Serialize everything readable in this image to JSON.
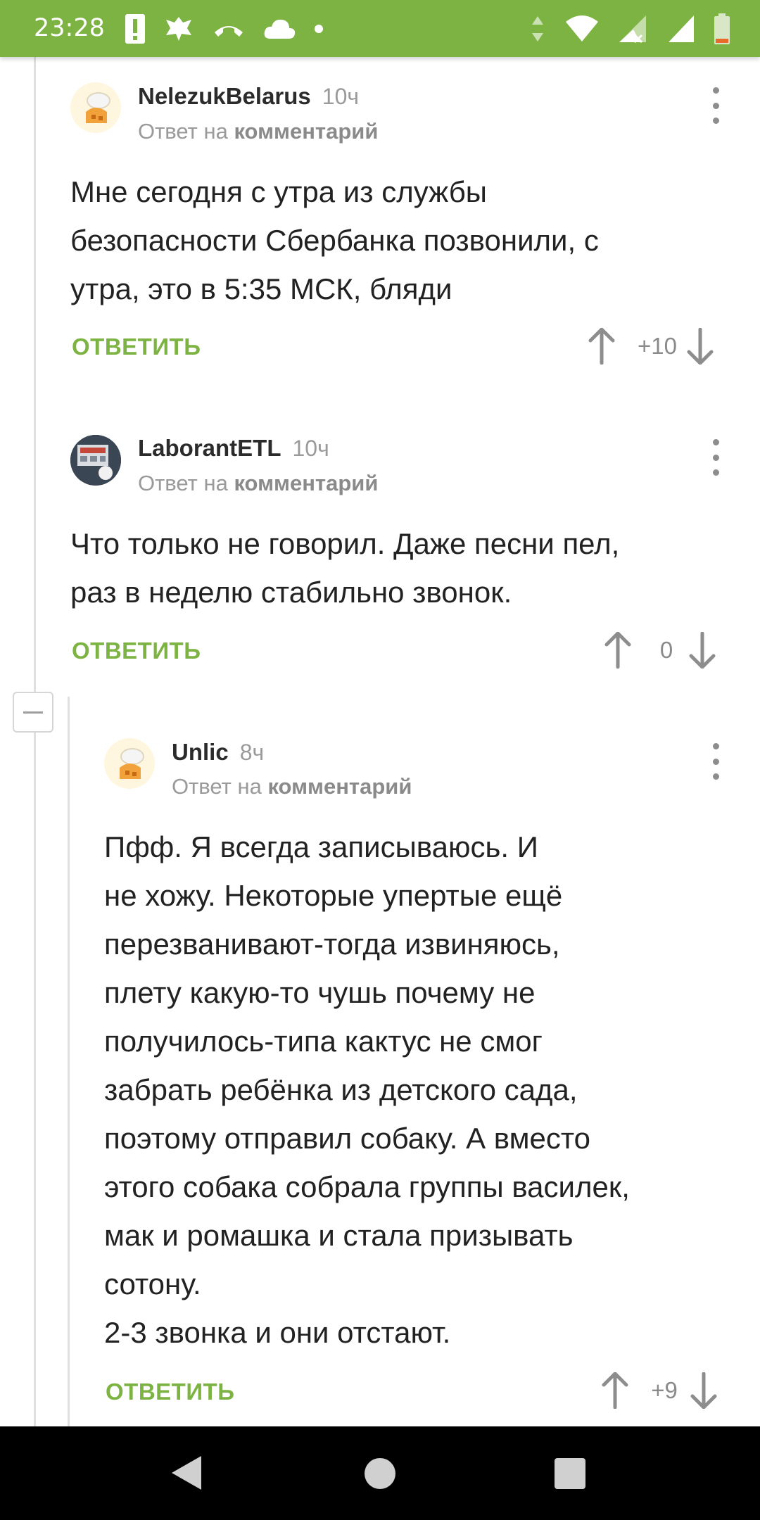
{
  "status_bar": {
    "time": "23:28",
    "left_icons": [
      "alert-icon",
      "emblem-icon",
      "missed-call-icon",
      "cloud-icon",
      "dot-icon"
    ],
    "right_icons": [
      "data-arrows-icon",
      "wifi-icon",
      "signal-no-data-icon",
      "signal-icon",
      "battery-icon"
    ]
  },
  "reply_label": "ОТВЕТИТЬ",
  "comments": [
    {
      "author": "NelezukBelarus",
      "time": "10ч",
      "reply_prefix": "Ответ на",
      "reply_link": "комментарий",
      "lines": [
        "Мне сегодня с утра из службы",
        "безопасности Сбербанка позвонили, с",
        "утра, это в 5:35 МСК, бляди"
      ],
      "score": "+10"
    },
    {
      "author": "LaborantETL",
      "time": "10ч",
      "reply_prefix": "Ответ на",
      "reply_link": "комментарий",
      "lines": [
        "Что только не говорил. Даже песни пел,",
        "раз в неделю стабильно звонок."
      ],
      "score": "0"
    },
    {
      "author": "Unlic",
      "time": "8ч",
      "reply_prefix": "Ответ на",
      "reply_link": "комментарий",
      "lines": [
        "Пфф. Я всегда записываюсь. И",
        "не хожу. Некоторые упертые ещё",
        "перезванивают-тогда извиняюсь,",
        "плету какую-то чушь почему не",
        "получилось-типа кактус не смог",
        "забрать ребёнка из детского сада,",
        "поэтому отправил собаку. А вместо",
        "этого собака собрала группы василек,",
        "мак и ромашка и стала призывать",
        "сотону.",
        "2-3 звонка и они отстают."
      ],
      "score": "+9"
    }
  ],
  "nav_bar": {
    "buttons": [
      "back-icon",
      "home-icon",
      "recents-icon"
    ]
  },
  "colors": {
    "accent": "#7cb342",
    "meta": "#9a9a9a",
    "text": "#222222"
  }
}
